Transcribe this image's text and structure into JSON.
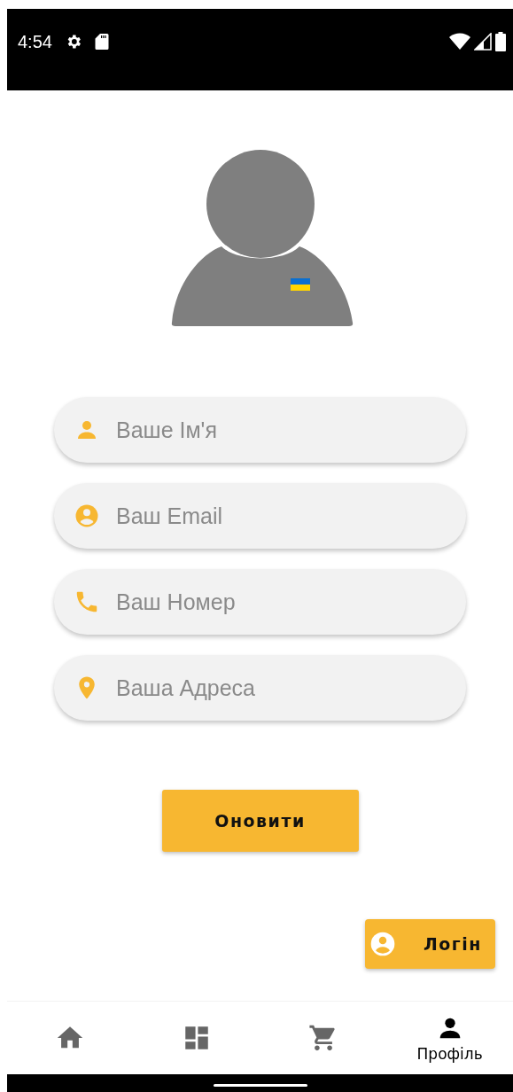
{
  "status_bar": {
    "time": "4:54"
  },
  "form": {
    "fields": [
      {
        "kind": "person",
        "placeholder": "Ваше Ім'я"
      },
      {
        "kind": "account",
        "placeholder": "Ваш Email"
      },
      {
        "kind": "phone",
        "placeholder": "Ваш Номер"
      },
      {
        "kind": "pin",
        "placeholder": "Ваша Адреса"
      }
    ],
    "submit": "Оновити"
  },
  "login_button": "Логін",
  "bottom_nav": [
    {
      "kind": "home",
      "selected": false
    },
    {
      "kind": "dashboard",
      "selected": false
    },
    {
      "kind": "cart",
      "selected": false
    },
    {
      "kind": "person",
      "label": "Профіль",
      "selected": true
    }
  ]
}
